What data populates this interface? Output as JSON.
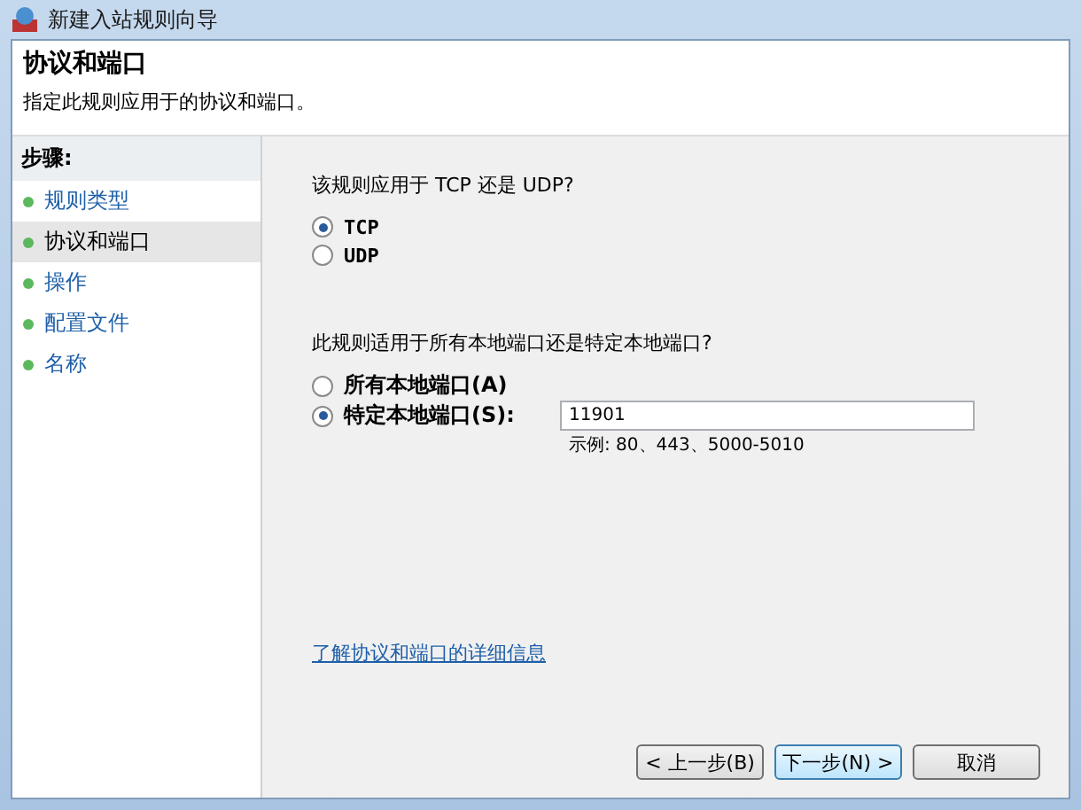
{
  "window": {
    "title": "新建入站规则向导"
  },
  "header": {
    "title": "协议和端口",
    "subtitle": "指定此规则应用于的协议和端口。"
  },
  "steps": {
    "heading": "步骤:",
    "items": [
      {
        "label": "规则类型",
        "selected": false
      },
      {
        "label": "协议和端口",
        "selected": true
      },
      {
        "label": "操作",
        "selected": false
      },
      {
        "label": "配置文件",
        "selected": false
      },
      {
        "label": "名称",
        "selected": false
      }
    ]
  },
  "protocol": {
    "question": "该规则应用于 TCP 还是 UDP?",
    "options": [
      {
        "label": "TCP",
        "selected": true
      },
      {
        "label": "UDP",
        "selected": false
      }
    ]
  },
  "ports": {
    "question": "此规则适用于所有本地端口还是特定本地端口?",
    "options": [
      {
        "label": "所有本地端口(A)",
        "selected": false
      },
      {
        "label": "特定本地端口(S):",
        "selected": true
      }
    ],
    "value": "11901",
    "example": "示例: 80、443、5000-5010"
  },
  "link": "了解协议和端口的详细信息",
  "buttons": [
    "< 上一步(B)",
    "下一步(N) >",
    "取消"
  ]
}
